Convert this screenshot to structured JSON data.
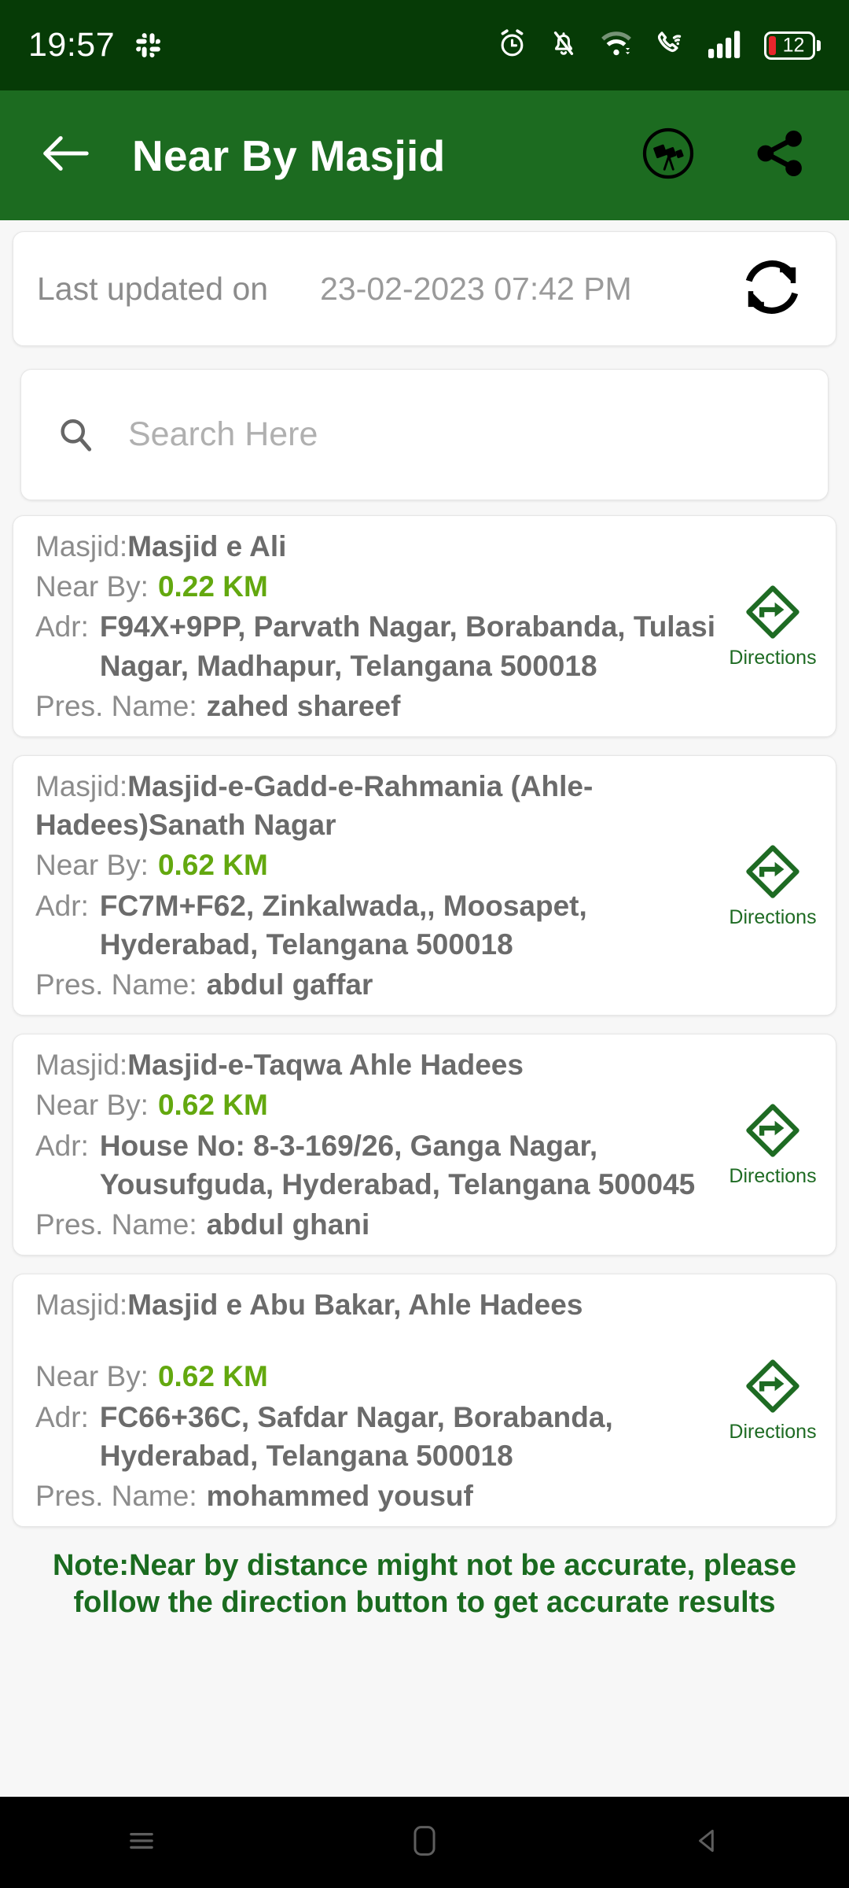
{
  "status_bar": {
    "clock": "19:57",
    "notification_icons": [
      "slack-icon"
    ],
    "system_icons": [
      "alarm-icon",
      "notifications-off-icon",
      "wifi-icon",
      "wifi-calling-icon",
      "signal-bars-icon"
    ],
    "battery_level": "12",
    "background_color": "#063b06"
  },
  "app_bar": {
    "title": "Near By Masjid",
    "back_icon": "back-arrow-icon",
    "telescope_icon": "telescope-icon",
    "share_icon": "share-icon",
    "background_color": "#1c6b20"
  },
  "last_updated": {
    "label": "Last updated on",
    "value": "23-02-2023 07:42 PM",
    "refresh_icon": "refresh-icon"
  },
  "search": {
    "placeholder": "Search Here",
    "value": "",
    "icon": "search-icon"
  },
  "labels": {
    "masjid": "Masjid:",
    "near_by": "Near By:",
    "adr": "Adr:",
    "pres_name": "Pres. Name:",
    "directions": "Directions"
  },
  "masjids": [
    {
      "name": "Masjid e Ali",
      "distance": "0.22 KM",
      "address": "F94X+9PP, Parvath Nagar, Borabanda, Tulasi Nagar, Madhapur, Telangana 500018",
      "president": "zahed shareef"
    },
    {
      "name": "Masjid-e-Gadd-e-Rahmania (Ahle-Hadees)Sanath Nagar",
      "distance": "0.62 KM",
      "address": "FC7M+F62, Zinkalwada,, Moosapet, Hyderabad, Telangana 500018",
      "president": "abdul gaffar"
    },
    {
      "name": "Masjid-e-Taqwa Ahle Hadees",
      "distance": "0.62 KM",
      "address": "House No: 8-3-169/26, Ganga Nagar, Yousufguda, Hyderabad, Telangana 500045",
      "president": "abdul ghani"
    },
    {
      "name": "Masjid e Abu Bakar, Ahle Hadees",
      "distance": "0.62 KM",
      "address": "FC66+36C, Safdar Nagar, Borabanda, Hyderabad, Telangana 500018",
      "president": "mohammed yousuf"
    }
  ],
  "note": "Note:Near by distance might not be accurate, please follow the direction button to get accurate results",
  "nav_bar": {
    "recents_icon": "recents-icon",
    "home_icon": "home-icon",
    "back_icon": "nav-back-icon"
  },
  "colors": {
    "status_bar": "#063b06",
    "app_bar": "#1c6b20",
    "distance_green": "#63a80f",
    "note_green": "#1a6b1f",
    "directions_green": "#1e6b23",
    "battery_red": "#e8262c"
  }
}
